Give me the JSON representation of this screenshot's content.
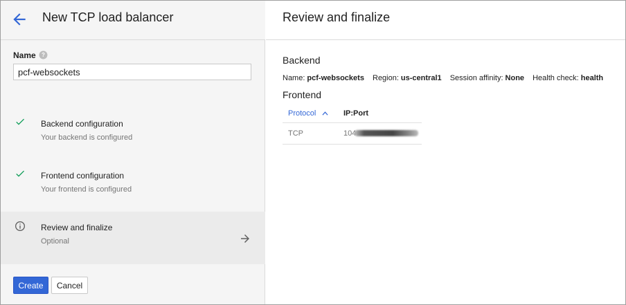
{
  "left": {
    "title": "New TCP load balancer",
    "name_label": "Name",
    "name_value": "pcf-websockets",
    "steps": [
      {
        "title": "Backend configuration",
        "subtitle": "Your backend is configured",
        "status": "done"
      },
      {
        "title": "Frontend configuration",
        "subtitle": "Your frontend is configured",
        "status": "done"
      },
      {
        "title": "Review and finalize",
        "subtitle": "Optional",
        "status": "active"
      }
    ],
    "create_label": "Create",
    "cancel_label": "Cancel"
  },
  "right": {
    "title": "Review and finalize",
    "backend": {
      "heading": "Backend",
      "name_label": "Name:",
      "name_value": "pcf-websockets",
      "region_label": "Region:",
      "region_value": "us-central1",
      "affinity_label": "Session affinity:",
      "affinity_value": "None",
      "health_label": "Health check:",
      "health_value": "health"
    },
    "frontend": {
      "heading": "Frontend",
      "columns": [
        "Protocol",
        "IP:Port"
      ],
      "rows": [
        {
          "protocol": "TCP",
          "ip_prefix": "104"
        }
      ]
    }
  },
  "colors": {
    "accent": "#3367d6",
    "check": "#0f9d58",
    "panel_bg": "#f5f5f5",
    "active_step_bg": "#ebebeb"
  },
  "icons": {
    "back": "arrow-left-icon",
    "help": "help-icon",
    "check": "check-icon",
    "info": "info-icon",
    "next": "arrow-right-icon",
    "sort": "sort-ascending-icon"
  }
}
